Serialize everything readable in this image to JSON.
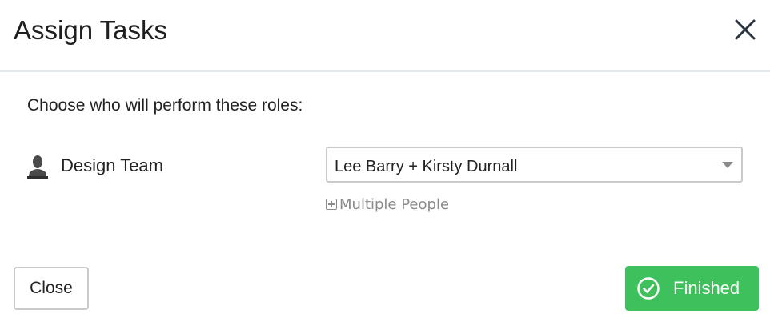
{
  "dialog": {
    "title": "Assign Tasks",
    "close_icon": "close-x-icon"
  },
  "body": {
    "prompt": "Choose who will perform these roles:",
    "roles": [
      {
        "icon": "person-icon",
        "label": "Design Team",
        "selected_value": "Lee Barry + Kirsty Durnall",
        "add_link_icon": "plus-square-icon",
        "add_link_label": "Multiple People"
      }
    ]
  },
  "footer": {
    "close_label": "Close",
    "finished_label": "Finished",
    "finished_icon": "check-circle-icon"
  },
  "colors": {
    "success": "#3ec05c",
    "border": "#c8cacc",
    "muted_text": "#8a8a8a",
    "divider": "#e6e9ec"
  }
}
